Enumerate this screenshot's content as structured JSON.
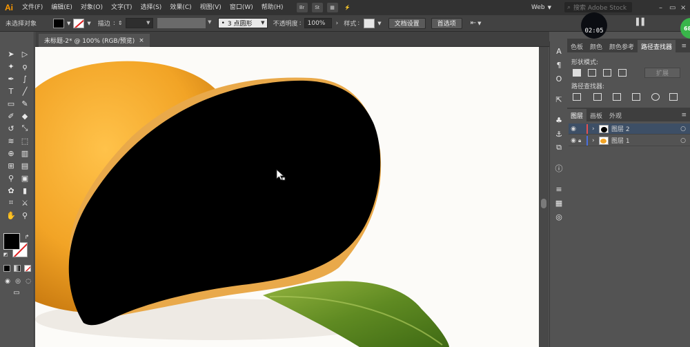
{
  "app": {
    "logo": "Ai",
    "timer": "02:05",
    "badge": "68"
  },
  "menu": [
    "文件(F)",
    "编辑(E)",
    "对象(O)",
    "文字(T)",
    "选择(S)",
    "效果(C)",
    "视图(V)",
    "窗口(W)",
    "帮助(H)"
  ],
  "menubar_buttons": [
    "Br",
    "St"
  ],
  "workspace": {
    "label": "Web",
    "search_placeholder": "搜索 Adobe Stock"
  },
  "controlbar": {
    "no_selection": "未选择对象",
    "stroke_label": "描边",
    "stroke_value": "",
    "brush_value": "3 点圆形",
    "opacity_label": "不透明度",
    "opacity_value": "100%",
    "style_label": "样式",
    "doc_setup": "文档设置",
    "prefs": "首选项"
  },
  "document": {
    "tab_title": "未标题-2* @ 100% (RGB/预览)",
    "close": "×"
  },
  "panels": {
    "tabs_top": [
      "色板",
      "颜色",
      "颜色参考",
      "路径查找器"
    ],
    "shape_modes": "形状模式:",
    "expand": "扩展",
    "pathfinder": "路径查找器:",
    "tabs_layers": [
      "图层",
      "画板",
      "外观"
    ],
    "layers": [
      {
        "name": "图层 2",
        "color": "#e85050"
      },
      {
        "name": "图层 1",
        "color": "#4a6fe0"
      }
    ]
  },
  "colors": {
    "accent": "#ff9a00",
    "layer_selected": "#3d4f66"
  }
}
